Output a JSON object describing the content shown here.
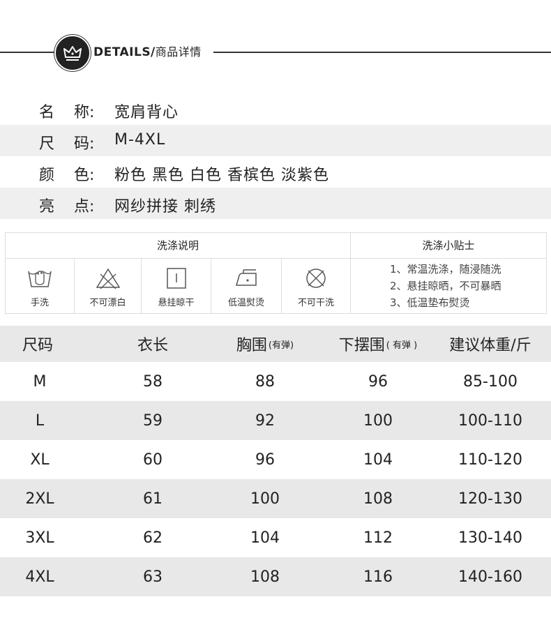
{
  "header": {
    "title_en": "DETAILS/",
    "title_cn": "商品详情"
  },
  "info": [
    {
      "label1": "名",
      "label2": "称:",
      "value": "宽肩背心"
    },
    {
      "label1": "尺",
      "label2": "码:",
      "value": "M-4XL"
    },
    {
      "label1": "颜",
      "label2": "色:",
      "value": "粉色 黑色 白色 香槟色 淡紫色"
    },
    {
      "label1": "亮",
      "label2": "点:",
      "value": "网纱拼接  刺绣"
    }
  ],
  "wash": {
    "left_title": "洗涤说明",
    "right_title": "洗涤小贴士",
    "icons": [
      {
        "icon": "hand-wash-icon",
        "label": "手洗"
      },
      {
        "icon": "no-bleach-icon",
        "label": "不可漂白"
      },
      {
        "icon": "hang-dry-icon",
        "label": "悬挂晾干"
      },
      {
        "icon": "low-iron-icon",
        "label": "低温熨烫"
      },
      {
        "icon": "no-dry-clean-icon",
        "label": "不可干洗"
      }
    ],
    "tips": [
      "1、常温洗涤，随浸随洗",
      "2、悬挂晾晒，不可暴晒",
      "3、低温垫布熨烫"
    ]
  },
  "size_table": {
    "headers": [
      {
        "main": "尺码",
        "sub": ""
      },
      {
        "main": "衣长",
        "sub": ""
      },
      {
        "main": "胸围",
        "sub": "(有弹)"
      },
      {
        "main": "下摆围",
        "sub": "( 有弹 )"
      },
      {
        "main": "建议体重/斤",
        "sub": ""
      }
    ],
    "rows": [
      [
        "M",
        "58",
        "88",
        "96",
        "85-100"
      ],
      [
        "L",
        "59",
        "92",
        "100",
        "100-110"
      ],
      [
        "XL",
        "60",
        "96",
        "104",
        "110-120"
      ],
      [
        "2XL",
        "61",
        "100",
        "108",
        "120-130"
      ],
      [
        "3XL",
        "62",
        "104",
        "112",
        "130-140"
      ],
      [
        "4XL",
        "63",
        "108",
        "116",
        "140-160"
      ]
    ]
  }
}
